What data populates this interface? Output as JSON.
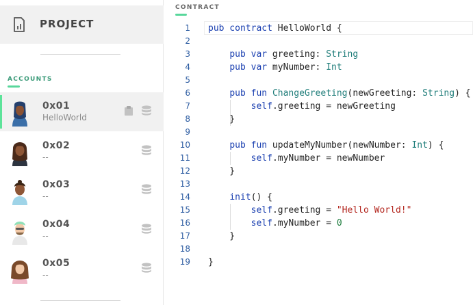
{
  "sidebar": {
    "project_title": "PROJECT",
    "accounts_label": "ACCOUNTS",
    "accounts": [
      {
        "address": "0x01",
        "contract": "HelloWorld",
        "active": true
      },
      {
        "address": "0x02",
        "contract": "--",
        "active": false
      },
      {
        "address": "0x03",
        "contract": "--",
        "active": false
      },
      {
        "address": "0x04",
        "contract": "--",
        "active": false
      },
      {
        "address": "0x05",
        "contract": "--",
        "active": false
      }
    ]
  },
  "editor": {
    "label": "CONTRACT",
    "line_numbers": [
      "1",
      "2",
      "3",
      "4",
      "5",
      "6",
      "7",
      "8",
      "9",
      "10",
      "11",
      "12",
      "13",
      "14",
      "15",
      "16",
      "17",
      "18",
      "19"
    ]
  },
  "colors": {
    "accent_green": "#58d79b",
    "keyword": "#1a3fb0",
    "type": "#1f7d7a",
    "string": "#b3261e"
  },
  "icons": {
    "project": "document-chart-icon",
    "copy": "clipboard-icon",
    "storage": "database-icon"
  }
}
